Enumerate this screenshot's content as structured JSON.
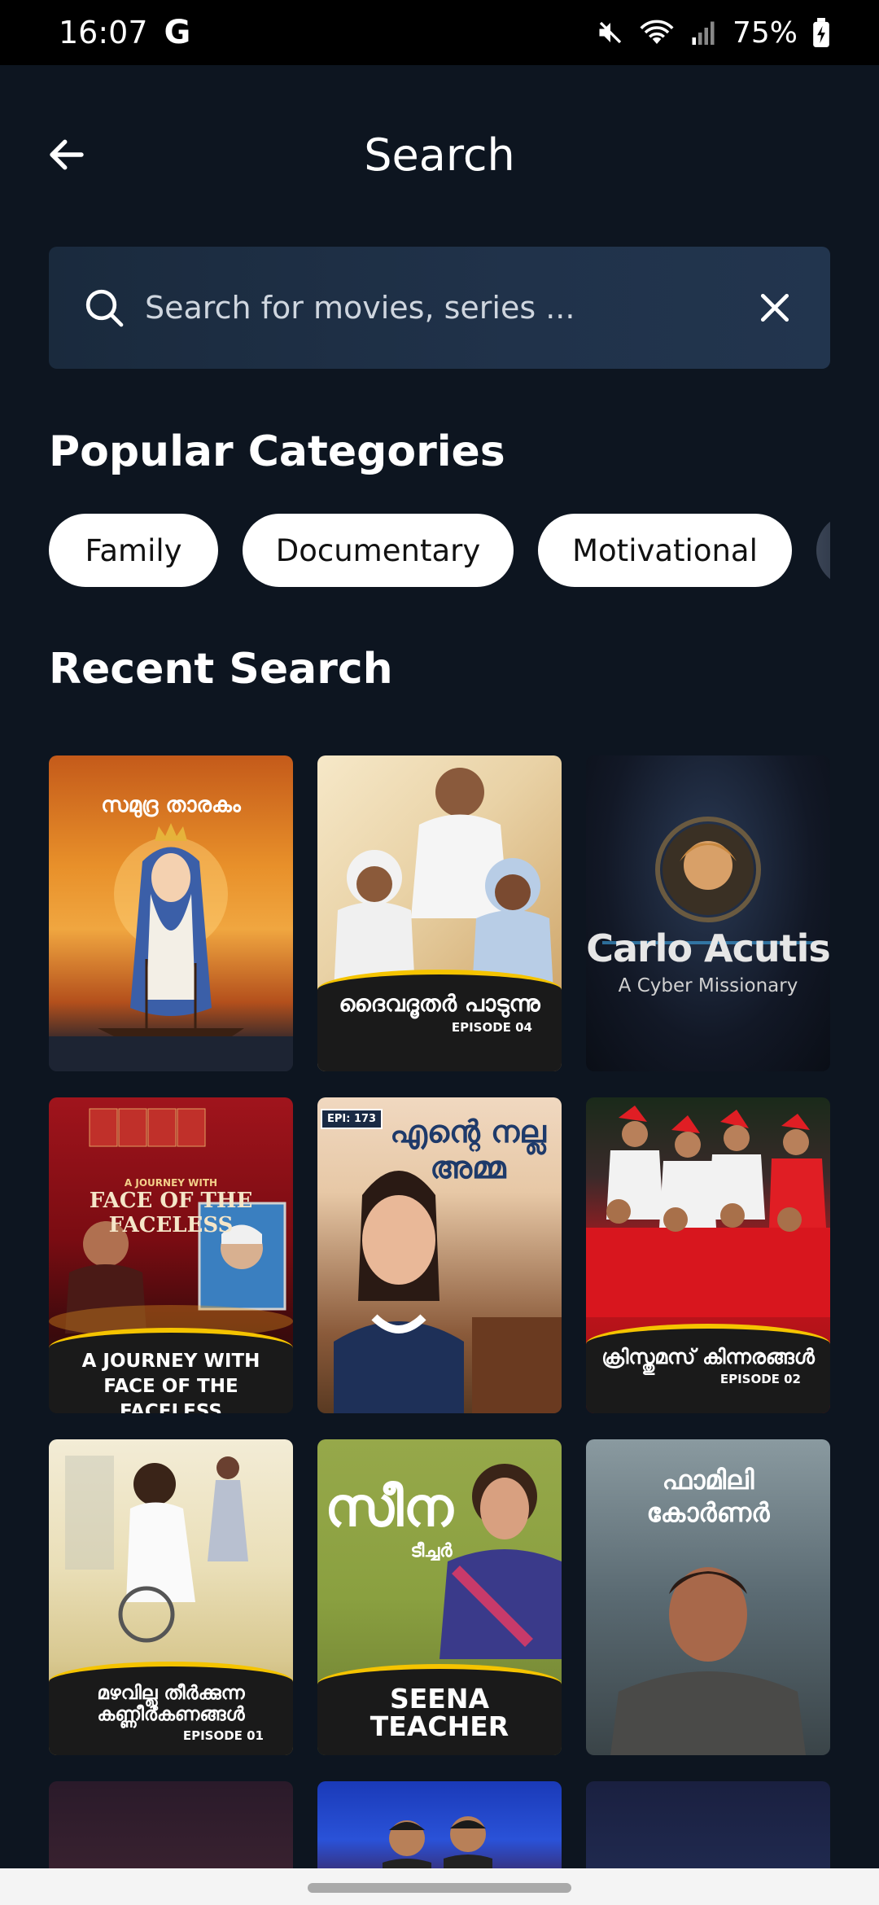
{
  "status_bar": {
    "time": "16:07",
    "carrier_icon": "G",
    "battery": "75%",
    "icons": [
      "mute-icon",
      "wifi-icon",
      "signal-icon",
      "battery-charging-icon"
    ]
  },
  "header": {
    "title": "Search",
    "back_icon": "arrow-left-icon"
  },
  "search": {
    "placeholder": "Search for movies, series ...",
    "value": "",
    "search_icon": "search-icon",
    "clear_icon": "close-icon"
  },
  "popular_categories": {
    "title": "Popular Categories",
    "chips": [
      "Family",
      "Documentary",
      "Motivational"
    ]
  },
  "recent_search": {
    "title": "Recent Search",
    "items": [
      {
        "title": "സമുദ്ര താരകം",
        "label": "",
        "episode": ""
      },
      {
        "title": "",
        "label": "ദൈവദൂതർ പാടുന്നു",
        "episode": "EPISODE 04"
      },
      {
        "title": "Carlo Acutis",
        "subtitle": "A Cyber Missionary",
        "label": "",
        "episode": ""
      },
      {
        "title": "FACE OF THE FACELESS",
        "kicker": "A JOURNEY WITH",
        "label": "A JOURNEY WITH FACE OF THE FACELESS",
        "episode": ""
      },
      {
        "title": "എന്റെ നല്ല അമ്മ",
        "badge": "EPI: 173",
        "label": "",
        "episode": ""
      },
      {
        "title": "",
        "label": "ക്രിസ്തുമസ് കിന്നരങ്ങൾ",
        "episode": "EPISODE 02"
      },
      {
        "title": "",
        "label": "മഴവില്ലു തീർക്കുന്ന കണ്ണീർകണങ്ങൾ",
        "episode": "EPISODE 01"
      },
      {
        "title": "സീന",
        "subtitle": "ടീച്ചർ",
        "label": "SEENA TEACHER",
        "episode": ""
      },
      {
        "title": "ഫാമിലി കോർണർ",
        "label": "",
        "episode": ""
      }
    ]
  },
  "colors": {
    "background": "#0d1520",
    "search_bg": "#1e2f45",
    "chip_bg": "#ffffff",
    "accent_gold": "#f5c400"
  }
}
